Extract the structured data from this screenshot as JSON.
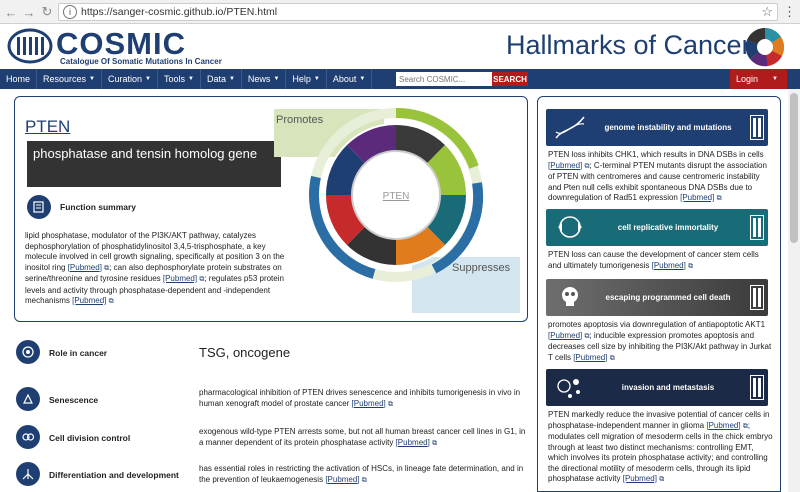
{
  "browser": {
    "url": "https://sanger-cosmic.github.io/PTEN.html",
    "back_icon": "←",
    "forward_icon": "→",
    "reload_icon": "↻",
    "star_icon": "☆",
    "menu_icon": "⋮"
  },
  "header": {
    "logo_title": "COSMIC",
    "logo_subtitle": "Catalogue Of Somatic Mutations In Cancer",
    "hallmarks_title": "Hallmarks of Cancer"
  },
  "nav": {
    "items": [
      {
        "label": "Home"
      },
      {
        "label": "Resources"
      },
      {
        "label": "Curation"
      },
      {
        "label": "Tools"
      },
      {
        "label": "Data"
      },
      {
        "label": "News"
      },
      {
        "label": "Help"
      },
      {
        "label": "About"
      }
    ],
    "search_placeholder": "Search COSMIC...",
    "search_button": "SEARCH",
    "login": "Login"
  },
  "gene": {
    "name": "PTEN",
    "full_name": "phosphatase and tensin homolog gene",
    "function_label": "Function summary",
    "function_text_1": "lipid phosphatase, modulator of the PI3K/AKT pathway, catalyzes dephosphorylation of phosphatidylinositol 3,4,5-trisphosphate, a key molecule involved in cell growth signaling, specifically at position 3 on the inositol ring ",
    "function_text_2": "; can also dephosphorylate protein substrates on serine/threonine and tyrosine residues ",
    "function_text_3": "; regulates p53 protein levels and activity through phosphatase-dependent and -independent mechanisms ",
    "pubmed": "[Pubmed]"
  },
  "graphic": {
    "promotes": "Promotes",
    "suppresses": "Suppresses",
    "center_label": "PTEN"
  },
  "rows": {
    "role_label": "Role in cancer",
    "role_value": "TSG, oncogene",
    "senescence_label": "Senescence",
    "senescence_text": "pharmacological inhibition of PTEN drives senescence and inhibits tumorigenesis in vivo in human xenograft model of prostate cancer ",
    "cell_division_label": "Cell division control",
    "cell_division_text": "exogenous wild-type PTEN arrests some, but not all human breast cancer cell lines in G1, in a manner dependent of its protein phosphatase activity ",
    "differentiation_label": "Differentiation and development",
    "differentiation_text": "has essential roles in restricting the activation of HSCs, in lineage fate determination, and in the prevention of leukaemogenesis "
  },
  "hallmarks": [
    {
      "label": "genome instability and mutations",
      "color": "#1f3f72",
      "text": "PTEN loss inhibits CHK1, which results in DNA DSBs in cells ",
      "text_2": "; C-terminal PTEN mutants disrupt the association of PTEN with centromeres and cause centromeric instability and Pten null cells exhibit spontaneous DNA DSBs due to downregulation of Rad51 expression "
    },
    {
      "label": "cell replicative immortality",
      "color": "#1a6b78",
      "text": "PTEN loss can cause the development of cancer stem cells and ultimately tumorigenesis ",
      "text_2": ""
    },
    {
      "label": "escaping programmed cell death",
      "color": "#555555",
      "text": "promotes apoptosis via downregulation of antiapoptotic AKT1 ",
      "text_2": "; inducible expression promotes apoptosis and decreases cell size by inhibiting the PI3K/Akt pathway in Jurkat T cells "
    },
    {
      "label": "invasion and metastasis",
      "color": "#1b2a46",
      "text": "PTEN markedly reduce the invasive potential of cancer cells in phosphatase-independent manner in glioma ",
      "text_2": "; modulates cell migration of mesoderm cells in the chick embryo through at least two distinct mechanisms: controlling EMT, which involves its protein phosphatase activity; and controlling the directional motility of mesoderm cells, through its lipid phosphatase activity "
    }
  ]
}
